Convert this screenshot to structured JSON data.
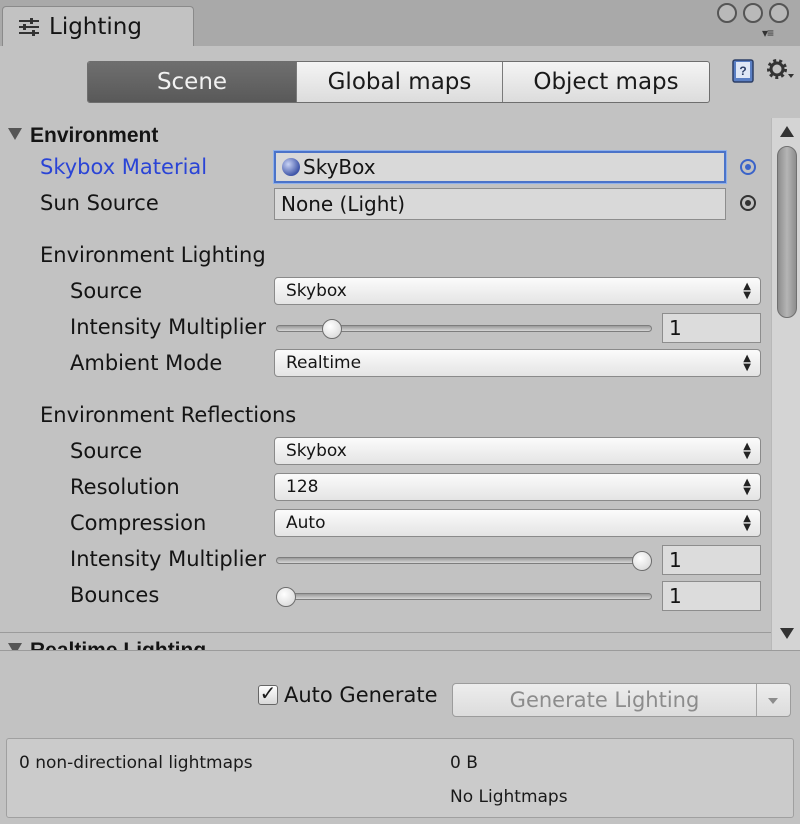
{
  "window": {
    "title": "Lighting",
    "title_icon": "sliders-icon",
    "window_buttons": [
      "circle-button",
      "circle-button",
      "circle-button"
    ]
  },
  "toolbar": {
    "tabs": [
      {
        "label": "Scene",
        "active": true
      },
      {
        "label": "Global maps",
        "active": false
      },
      {
        "label": "Object maps",
        "active": false
      }
    ],
    "help_icon": "book-help-icon",
    "settings_icon": "gear-icon"
  },
  "environment": {
    "header": "Environment",
    "skybox_material": {
      "label": "Skybox Material",
      "value": "SkyBox"
    },
    "sun_source": {
      "label": "Sun Source",
      "value": "None (Light)"
    },
    "lighting": {
      "header": "Environment Lighting",
      "source": {
        "label": "Source",
        "value": "Skybox"
      },
      "intensity": {
        "label": "Intensity Multiplier",
        "value": "1",
        "slider_fraction": 0.13
      },
      "ambient_mode": {
        "label": "Ambient Mode",
        "value": "Realtime"
      }
    },
    "reflections": {
      "header": "Environment Reflections",
      "source": {
        "label": "Source",
        "value": "Skybox"
      },
      "resolution": {
        "label": "Resolution",
        "value": "128"
      },
      "compression": {
        "label": "Compression",
        "value": "Auto"
      },
      "intensity": {
        "label": "Intensity Multiplier",
        "value": "1",
        "slider_fraction": 1.0
      },
      "bounces": {
        "label": "Bounces",
        "value": "1",
        "slider_fraction": 0.0
      }
    }
  },
  "realtime": {
    "header": "Realtime Lighting"
  },
  "generate": {
    "auto_label": "Auto Generate",
    "auto_checked": true,
    "button_label": "Generate Lighting"
  },
  "stats": {
    "lightmaps": "0 non-directional lightmaps",
    "size": "0 B",
    "status": "No Lightmaps"
  },
  "colors": {
    "accent_blue": "#2a44d6",
    "selected_tab": "#646464",
    "panel_bg": "#c2c2c2"
  }
}
